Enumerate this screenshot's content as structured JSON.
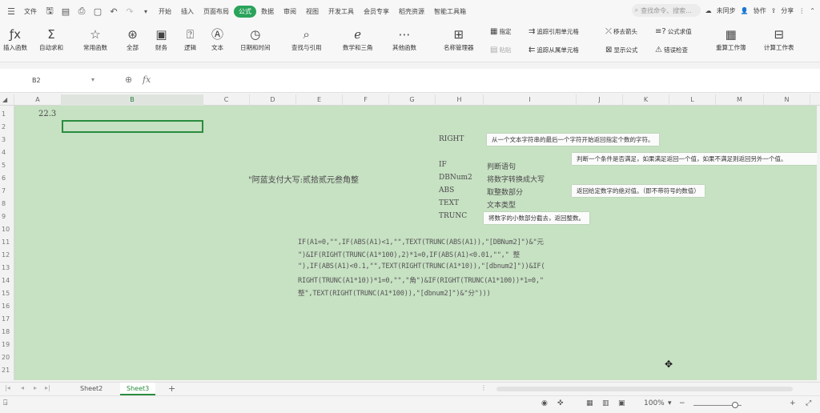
{
  "menubar": {
    "file": "文件",
    "tabs": [
      "开始",
      "插入",
      "页面布局",
      "公式",
      "数据",
      "审阅",
      "视图",
      "开发工具",
      "会员专享",
      "稻壳资源",
      "智能工具箱"
    ],
    "active_tab": "公式",
    "search_placeholder": "查找命令、搜索...",
    "right": {
      "unsynced": "未同步",
      "collab": "协作",
      "share": "分享"
    }
  },
  "ribbon": {
    "buttons": [
      {
        "label": "插入函数",
        "icon": "fx-icon"
      },
      {
        "label": "自动求和",
        "icon": "sum-icon"
      },
      {
        "label": "常用函数",
        "icon": "star-icon"
      },
      {
        "label": "全部",
        "icon": "all-functions-icon"
      },
      {
        "label": "财务",
        "icon": "finance-icon"
      },
      {
        "label": "逻辑",
        "icon": "logic-icon"
      },
      {
        "label": "文本",
        "icon": "text-icon"
      },
      {
        "label": "日期和时间",
        "icon": "clock-icon"
      },
      {
        "label": "查找与引用",
        "icon": "lookup-icon"
      },
      {
        "label": "数学和三角",
        "icon": "math-icon"
      },
      {
        "label": "其他函数",
        "icon": "more-icon"
      },
      {
        "label": "名称管理器",
        "icon": "name-manager-icon"
      }
    ],
    "small": {
      "paste": "指定",
      "paste_disabled": "粘贴",
      "trace_precedents": "追踪引用单元格",
      "trace_dependents": "追踪从属单元格",
      "remove_arrows": "移去箭头",
      "show_formulas": "显示公式",
      "formula_audit": "公式求值",
      "error_check": "错误检查"
    },
    "recalc": "重算工作簿",
    "calc_sheet": "计算工作表"
  },
  "formula_bar": {
    "name_box": "B2",
    "fx": "fx"
  },
  "columns": [
    "A",
    "B",
    "C",
    "D",
    "E",
    "F",
    "G",
    "H",
    "I",
    "J",
    "K",
    "L",
    "M",
    "N"
  ],
  "selected_column": "B",
  "rows": [
    "1",
    "2",
    "3",
    "4",
    "5",
    "6",
    "7",
    "8",
    "9",
    "10",
    "11",
    "12",
    "13",
    "14",
    "15",
    "16",
    "17",
    "18",
    "19",
    "20",
    "21"
  ],
  "cells": {
    "a1": "22.3",
    "title": "\"阿蓝支付大写:贰拾贰元叁角整",
    "functions": [
      {
        "name": "RIGHT",
        "desc": ""
      },
      {
        "name": "IF",
        "desc": "判断语句"
      },
      {
        "name": "DBNum2",
        "desc": "将数字转换成大写"
      },
      {
        "name": "ABS",
        "desc": "取整数部分"
      },
      {
        "name": "TEXT",
        "desc": "文本类型"
      },
      {
        "name": "TRUNC",
        "desc": ""
      }
    ],
    "formula_lines": [
      "IF(A1=0,\"\",IF(ABS(A1)<1,\"\",TEXT(TRUNC(ABS(A1)),\"[DBNum2]\")&\"元",
      "\")&IF(RIGHT(TRUNC(A1*100),2)*1=0,IF(ABS(A1)<0.01,\"\",\"         整",
      "\"),IF(ABS(A1)<0.1,\"\",TEXT(RIGHT(TRUNC(A1*10)),\"[dbnum2]\"))&IF(",
      "RIGHT(TRUNC(A1*10))*1=0,\"\",\"角\")&IF(RIGHT(TRUNC(A1*100))*1=0,\"",
      "整\",TEXT(RIGHT(TRUNC(A1*100)),\"[dbnum2]\")&\"分\")))"
    ]
  },
  "tooltips": {
    "right": "从一个文本字符串的最后一个字符开始返回指定个数的字符。",
    "if": "判断一个条件是否满足，如果满足返回一个值，如果不满足则返回另外一个值。",
    "abs": "返回给定数字的绝对值。（即不带符号的数值）",
    "trunc": "将数字的小数部分截去，返回整数。"
  },
  "sheet_tabs": [
    "Sheet2",
    "Sheet3"
  ],
  "active_sheet": "Sheet3",
  "statusbar": {
    "zoom": "100%"
  },
  "colors": {
    "accent": "#2a8c3e",
    "sheet_bg": "#c7e1c3"
  }
}
